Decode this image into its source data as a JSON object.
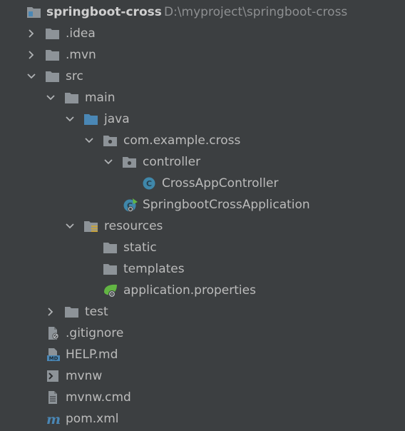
{
  "project": {
    "name": "springboot-cross",
    "path": "D:\\myproject\\springboot-cross"
  },
  "items": [
    {
      "label": ".idea"
    },
    {
      "label": ".mvn"
    },
    {
      "label": "src"
    },
    {
      "label": "main"
    },
    {
      "label": "java"
    },
    {
      "label": "com.example.cross"
    },
    {
      "label": "controller"
    },
    {
      "label": "CrossAppController"
    },
    {
      "label": "SpringbootCrossApplication"
    },
    {
      "label": "resources"
    },
    {
      "label": "static"
    },
    {
      "label": "templates"
    },
    {
      "label": "application.properties"
    },
    {
      "label": "test"
    },
    {
      "label": ".gitignore"
    },
    {
      "label": "HELP.md"
    },
    {
      "label": "mvnw"
    },
    {
      "label": "mvnw.cmd"
    },
    {
      "label": "pom.xml"
    }
  ],
  "icons": {
    "root": "project-folder-icon",
    "idea": "folder-icon",
    "mvn": "folder-icon",
    "src": "folder-icon",
    "main": "folder-icon",
    "java": "source-root-folder-icon",
    "package": "package-folder-icon",
    "class": "java-class-icon",
    "spring_app": "spring-boot-application-icon",
    "resources": "resources-root-folder-icon",
    "properties": "spring-properties-icon",
    "gitignore": "gitignore-file-icon",
    "markdown": "markdown-file-icon",
    "shell": "shell-script-icon",
    "text": "text-file-icon",
    "maven": "maven-pom-icon"
  },
  "colors": {
    "background": "#3c3f41",
    "text": "#bbbbbb",
    "path_text": "#8d8f91",
    "folder": "#8d9398",
    "source_folder": "#4a87b5",
    "class_icon": "#3f87aa",
    "spring_green": "#62b543",
    "maven_blue": "#4a87b5"
  }
}
